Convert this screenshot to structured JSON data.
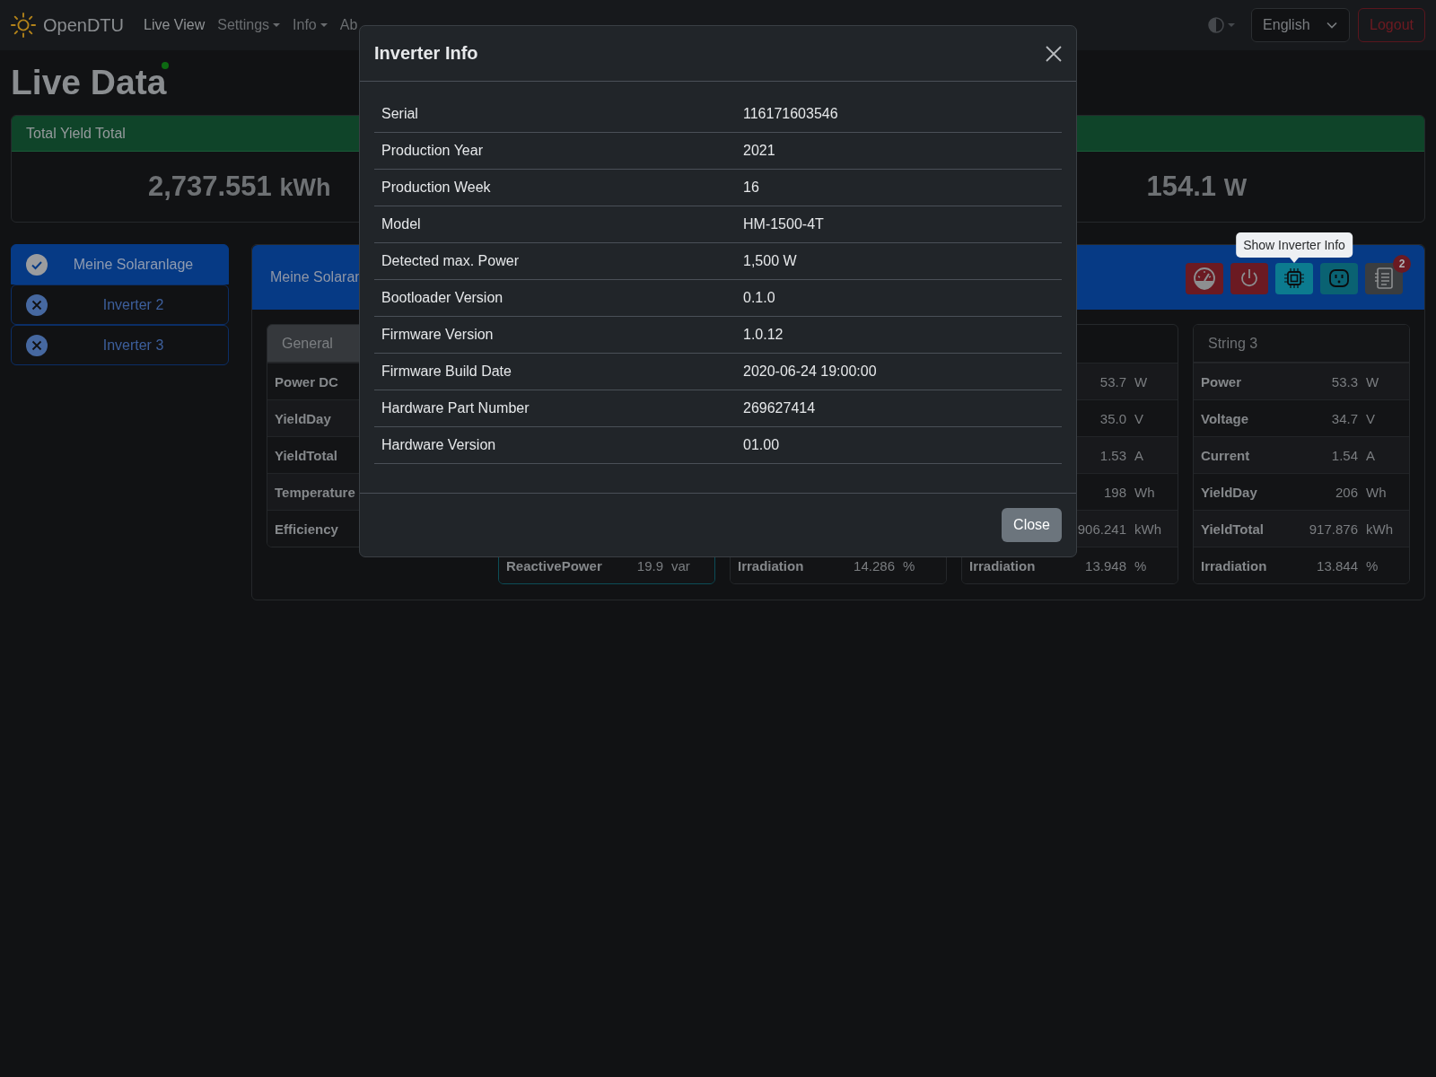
{
  "navbar": {
    "brand": "OpenDTU",
    "links": [
      {
        "label": "Live View",
        "selected": true,
        "dropdown": false
      },
      {
        "label": "Settings",
        "selected": false,
        "dropdown": true
      },
      {
        "label": "Info",
        "selected": false,
        "dropdown": true
      },
      {
        "label": "Ab",
        "selected": false,
        "dropdown": false
      }
    ],
    "language": "English",
    "logout": "Logout"
  },
  "page": {
    "title": "Live Data",
    "connected": true
  },
  "totals": [
    {
      "title": "Total Yield Total",
      "value": "2,737.551",
      "unit": "kWh"
    },
    {
      "value": "154.1",
      "unit": "W"
    }
  ],
  "inverters": [
    {
      "label": "Meine Solaranlage",
      "selected": true,
      "reachable": true
    },
    {
      "label": "Inverter 2",
      "selected": false,
      "reachable": false
    },
    {
      "label": "Inverter 3",
      "selected": false,
      "reachable": false
    }
  ],
  "panel": {
    "title": "Meine Solaran",
    "actions": [
      {
        "kind": "gauge",
        "hovered": false
      },
      {
        "kind": "power",
        "hovered": false
      },
      {
        "kind": "chip",
        "hovered": true,
        "tooltip": "Show Inverter Info"
      },
      {
        "kind": "outlet",
        "hovered": false
      },
      {
        "kind": "log",
        "hovered": false,
        "badge": "2"
      }
    ],
    "cards": [
      {
        "kind": "inverter",
        "title": "General",
        "rows": [
          {
            "label": "Power DC"
          },
          {
            "label": "YieldDay"
          },
          {
            "label": "YieldTotal"
          },
          {
            "label": "Temperature"
          },
          {
            "label": "Efficiency"
          }
        ]
      },
      {
        "kind": "ac",
        "rows": [
          {
            "label": "ReactivePower",
            "value": "19.9",
            "unit": "var"
          }
        ]
      },
      {
        "kind": "string",
        "rows": [
          {
            "label": "Irradiation",
            "value": "14.286",
            "unit": "%"
          }
        ]
      },
      {
        "kind": "string",
        "rows": [
          {
            "value": "53.7",
            "unit": "W"
          },
          {
            "value": "35.0",
            "unit": "V"
          },
          {
            "value": "1.53",
            "unit": "A"
          },
          {
            "value": "198",
            "unit": "Wh"
          },
          {
            "value": "906.241",
            "unit": "kWh"
          },
          {
            "label": "Irradiation",
            "value": "13.948",
            "unit": "%"
          }
        ]
      },
      {
        "kind": "string",
        "title": "String 3",
        "rows": [
          {
            "label": "Power",
            "value": "53.3",
            "unit": "W"
          },
          {
            "label": "Voltage",
            "value": "34.7",
            "unit": "V"
          },
          {
            "label": "Current",
            "value": "1.54",
            "unit": "A"
          },
          {
            "label": "YieldDay",
            "value": "206",
            "unit": "Wh"
          },
          {
            "label": "YieldTotal",
            "value": "917.876",
            "unit": "kWh"
          },
          {
            "label": "Irradiation",
            "value": "13.844",
            "unit": "%"
          }
        ]
      }
    ]
  },
  "modal": {
    "title": "Inverter Info",
    "rows": [
      {
        "label": "Serial",
        "value": "116171603546"
      },
      {
        "label": "Production Year",
        "value": "2021"
      },
      {
        "label": "Production Week",
        "value": "16"
      },
      {
        "label": "Model",
        "value": "HM-1500-4T"
      },
      {
        "label": "Detected max. Power",
        "value": "1,500 W"
      },
      {
        "label": "Bootloader Version",
        "value": "0.1.0"
      },
      {
        "label": "Firmware Version",
        "value": "1.0.12"
      },
      {
        "label": "Firmware Build Date",
        "value": "2020-06-24 19:00:00"
      },
      {
        "label": "Hardware Part Number",
        "value": "269627414"
      },
      {
        "label": "Hardware Version",
        "value": "01.00"
      }
    ],
    "button": "Close"
  }
}
